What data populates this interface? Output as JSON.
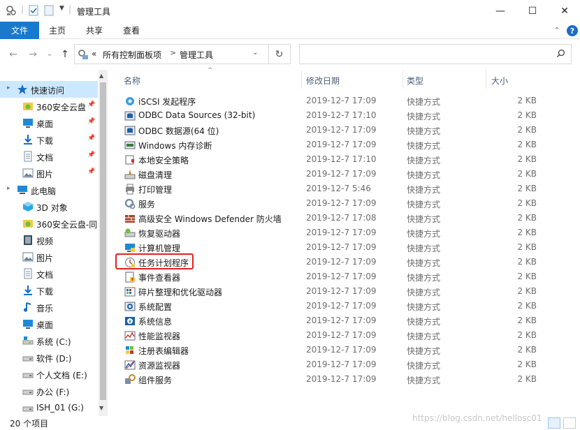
{
  "window": {
    "title": "管理工具",
    "controls": {
      "minimize": "—",
      "maximize": "☐",
      "close": "✕"
    }
  },
  "ribbon": {
    "file": "文件",
    "tabs": [
      "主页",
      "共享",
      "查看"
    ],
    "help": "?"
  },
  "nav": {
    "back": "←",
    "forward": "→",
    "recent": "⌄",
    "up": "↑",
    "breadcrumb": {
      "overflow": "«",
      "path": [
        "所有控制面板项",
        "管理工具"
      ]
    },
    "refresh": "↻",
    "search_placeholder": ""
  },
  "sidebar": {
    "items": [
      {
        "label": "快速访问",
        "icon": "star-icon",
        "color": "#1b6cc7",
        "level": 0,
        "selected": true,
        "pinned": false
      },
      {
        "label": "360安全云盘",
        "icon": "cloud-drive-icon",
        "color": "#6cbf3e",
        "level": 1,
        "pinned": true
      },
      {
        "label": "桌面",
        "icon": "desktop-icon",
        "color": "#1b8ad9",
        "level": 1,
        "pinned": true
      },
      {
        "label": "下载",
        "icon": "download-icon",
        "color": "#1b6cc7",
        "level": 1,
        "pinned": true
      },
      {
        "label": "文档",
        "icon": "document-icon",
        "color": "#7a8ea8",
        "level": 1,
        "pinned": true
      },
      {
        "label": "图片",
        "icon": "pictures-icon",
        "color": "#6b7f99",
        "level": 1,
        "pinned": true
      },
      {
        "label": "此电脑",
        "icon": "computer-icon",
        "color": "#1b8ad9",
        "level": 0,
        "pinned": false
      },
      {
        "label": "3D 对象",
        "icon": "3d-objects-icon",
        "color": "#29a8e0",
        "level": 1,
        "pinned": false
      },
      {
        "label": "360安全云盘-同",
        "icon": "cloud-drive-icon",
        "color": "#6cbf3e",
        "level": 1,
        "pinned": false
      },
      {
        "label": "视频",
        "icon": "video-icon",
        "color": "#3a4a5e",
        "level": 1,
        "pinned": false
      },
      {
        "label": "图片",
        "icon": "pictures-icon",
        "color": "#6b7f99",
        "level": 1,
        "pinned": false
      },
      {
        "label": "文档",
        "icon": "document-icon",
        "color": "#7a8ea8",
        "level": 1,
        "pinned": false
      },
      {
        "label": "下载",
        "icon": "download-icon",
        "color": "#1b6cc7",
        "level": 1,
        "pinned": false
      },
      {
        "label": "音乐",
        "icon": "music-icon",
        "color": "#1b6cc7",
        "level": 1,
        "pinned": false
      },
      {
        "label": "桌面",
        "icon": "desktop-icon",
        "color": "#1b8ad9",
        "level": 1,
        "pinned": false
      },
      {
        "label": "系统 (C:)",
        "icon": "system-drive-icon",
        "color": "#555555",
        "level": 1,
        "pinned": false
      },
      {
        "label": "软件 (D:)",
        "icon": "drive-icon",
        "color": "#555555",
        "level": 1,
        "pinned": false
      },
      {
        "label": "个人文档 (E:)",
        "icon": "drive-icon",
        "color": "#555555",
        "level": 1,
        "pinned": false
      },
      {
        "label": "办公 (F:)",
        "icon": "drive-icon",
        "color": "#555555",
        "level": 1,
        "pinned": false
      },
      {
        "label": "ISH_01 (G:)",
        "icon": "drive-icon",
        "color": "#555555",
        "level": 1,
        "pinned": false
      }
    ]
  },
  "columns": [
    "名称",
    "修改日期",
    "类型",
    "大小"
  ],
  "files": [
    {
      "name": "iSCSI 发起程序",
      "date": "2019-12-7 17:09",
      "type": "快捷方式",
      "size": "2 KB",
      "icon": "iscsi-icon"
    },
    {
      "name": "ODBC Data Sources (32-bit)",
      "date": "2019-12-7 17:10",
      "type": "快捷方式",
      "size": "2 KB",
      "icon": "odbc-icon"
    },
    {
      "name": "ODBC 数据源(64 位)",
      "date": "2019-12-7 17:09",
      "type": "快捷方式",
      "size": "2 KB",
      "icon": "odbc-icon"
    },
    {
      "name": "Windows 内存诊断",
      "date": "2019-12-7 17:09",
      "type": "快捷方式",
      "size": "2 KB",
      "icon": "memory-diagnostic-icon"
    },
    {
      "name": "本地安全策略",
      "date": "2019-12-7 17:10",
      "type": "快捷方式",
      "size": "2 KB",
      "icon": "security-policy-icon"
    },
    {
      "name": "磁盘清理",
      "date": "2019-12-7 17:09",
      "type": "快捷方式",
      "size": "2 KB",
      "icon": "disk-cleanup-icon"
    },
    {
      "name": "打印管理",
      "date": "2019-12-7 5:46",
      "type": "快捷方式",
      "size": "2 KB",
      "icon": "print-management-icon"
    },
    {
      "name": "服务",
      "date": "2019-12-7 17:09",
      "type": "快捷方式",
      "size": "2 KB",
      "icon": "services-icon"
    },
    {
      "name": "高级安全 Windows Defender 防火墙",
      "date": "2019-12-7 17:08",
      "type": "快捷方式",
      "size": "2 KB",
      "icon": "firewall-icon"
    },
    {
      "name": "恢复驱动器",
      "date": "2019-12-7 17:09",
      "type": "快捷方式",
      "size": "2 KB",
      "icon": "recovery-drive-icon"
    },
    {
      "name": "计算机管理",
      "date": "2019-12-7 17:09",
      "type": "快捷方式",
      "size": "2 KB",
      "icon": "computer-management-icon"
    },
    {
      "name": "任务计划程序",
      "date": "2019-12-7 17:09",
      "type": "快捷方式",
      "size": "2 KB",
      "icon": "task-scheduler-icon",
      "highlighted": true
    },
    {
      "name": "事件查看器",
      "date": "2019-12-7 17:09",
      "type": "快捷方式",
      "size": "2 KB",
      "icon": "event-viewer-icon"
    },
    {
      "name": "碎片整理和优化驱动器",
      "date": "2019-12-7 17:09",
      "type": "快捷方式",
      "size": "2 KB",
      "icon": "defrag-icon"
    },
    {
      "name": "系统配置",
      "date": "2019-12-7 17:09",
      "type": "快捷方式",
      "size": "2 KB",
      "icon": "system-config-icon"
    },
    {
      "name": "系统信息",
      "date": "2019-12-7 17:09",
      "type": "快捷方式",
      "size": "2 KB",
      "icon": "system-info-icon"
    },
    {
      "name": "性能监视器",
      "date": "2019-12-7 17:09",
      "type": "快捷方式",
      "size": "2 KB",
      "icon": "performance-monitor-icon"
    },
    {
      "name": "注册表编辑器",
      "date": "2019-12-7 17:09",
      "type": "快捷方式",
      "size": "2 KB",
      "icon": "registry-editor-icon"
    },
    {
      "name": "资源监视器",
      "date": "2019-12-7 17:09",
      "type": "快捷方式",
      "size": "2 KB",
      "icon": "resource-monitor-icon"
    },
    {
      "name": "组件服务",
      "date": "2019-12-7 17:09",
      "type": "快捷方式",
      "size": "2 KB",
      "icon": "component-services-icon"
    }
  ],
  "status": {
    "count": "20 个项目",
    "watermark": "https://blog.csdn.net/hellosc01"
  },
  "colors": {
    "accent": "#1979ca",
    "selected": "#cce8ff",
    "highlight": "#e0211f",
    "header_text": "#4c607a"
  }
}
